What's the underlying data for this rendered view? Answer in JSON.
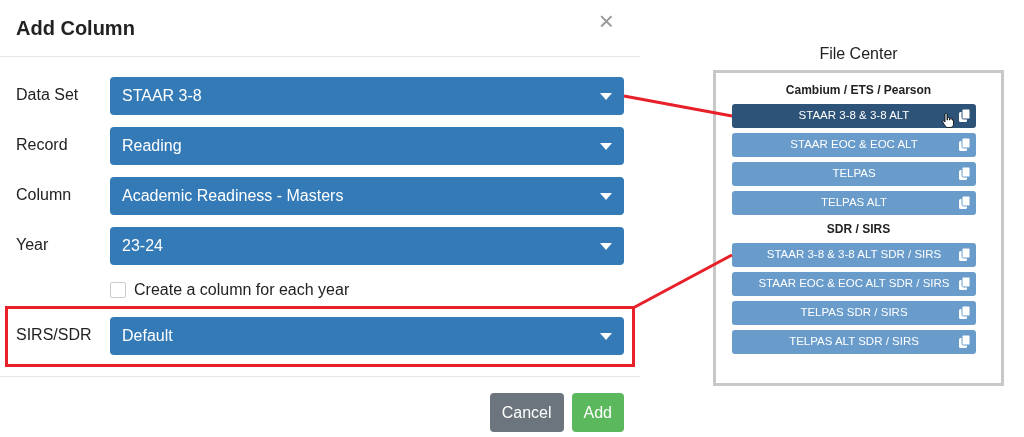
{
  "dialog": {
    "title": "Add Column",
    "close": "×",
    "fields": [
      {
        "label": "Data Set",
        "value": "STAAR 3-8",
        "highlighted": false
      },
      {
        "label": "Record",
        "value": "Reading",
        "highlighted": false
      },
      {
        "label": "Column",
        "value": "Academic Readiness - Masters",
        "highlighted": false
      },
      {
        "label": "Year",
        "value": "23-24",
        "highlighted": false
      },
      {
        "kind": "checkbox",
        "label": "Create a column for each year",
        "checked": false
      },
      {
        "label": "SIRS/SDR",
        "value": "Default",
        "highlighted": true
      }
    ],
    "buttons": [
      {
        "label": "Cancel",
        "kind": "secondary"
      },
      {
        "label": "Add",
        "kind": "primary"
      }
    ]
  },
  "file_center": {
    "title": "File Center",
    "groups": [
      {
        "heading": "Cambium / ETS / Pearson",
        "items": [
          {
            "label": "STAAR 3-8 & 3-8 ALT",
            "selected": true
          },
          {
            "label": "STAAR EOC & EOC ALT",
            "selected": false
          },
          {
            "label": "TELPAS",
            "selected": false
          },
          {
            "label": "TELPAS ALT",
            "selected": false
          }
        ]
      },
      {
        "heading": "SDR / SIRS",
        "items": [
          {
            "label": "STAAR 3-8 & 3-8 ALT SDR / SIRS",
            "selected": false
          },
          {
            "label": "STAAR EOC & EOC ALT SDR / SIRS",
            "selected": false
          },
          {
            "label": "TELPAS SDR / SIRS",
            "selected": false
          },
          {
            "label": "TELPAS ALT SDR / SIRS",
            "selected": false
          }
        ]
      }
    ]
  }
}
